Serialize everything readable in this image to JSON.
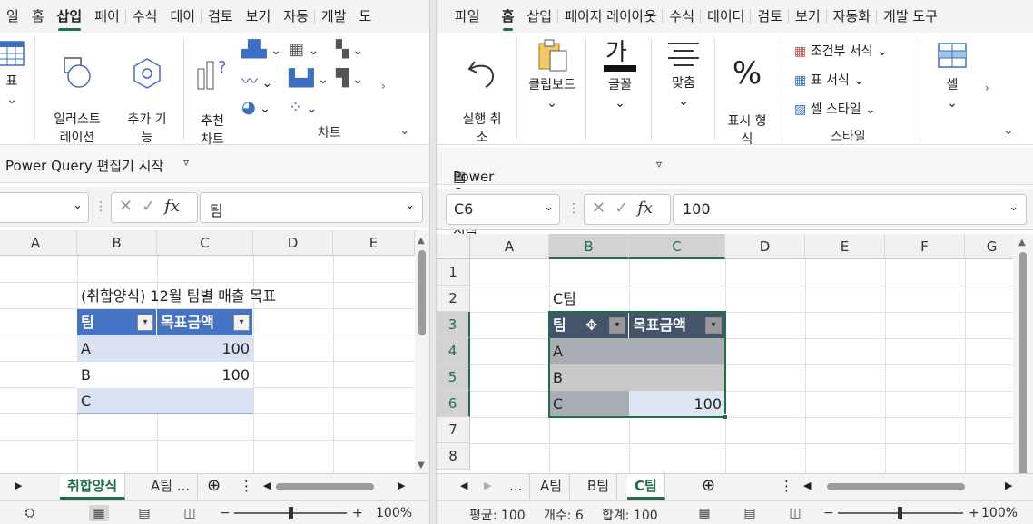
{
  "left": {
    "tabs": [
      "일",
      "홈",
      "삽입",
      "페이",
      "수식",
      "데이",
      "검토",
      "보기",
      "자동",
      "개발",
      "도"
    ],
    "ribbon": {
      "table_label": "표",
      "illustrations_label": "일러스트\n레이션",
      "addins_label": "추가 기\n능",
      "recommended_label": "추천\n차트",
      "charts_group": "차트"
    },
    "query_bar": "Power Query 편집기 시작",
    "formula": {
      "name": "",
      "value": "팀"
    },
    "columns": [
      "A",
      "B",
      "C",
      "D",
      "E"
    ],
    "title": "(취합양식) 12월 팀별 매출 목표",
    "table": {
      "headers": [
        "팀",
        "목표금액"
      ],
      "rows": [
        [
          "A",
          "100"
        ],
        [
          "B",
          "100"
        ],
        [
          "C",
          ""
        ]
      ]
    },
    "sheets": [
      "취합양식",
      "A팀 ..."
    ],
    "zoom": "100%"
  },
  "right": {
    "tabs": [
      "파일",
      "홈",
      "삽입",
      "페이지 레이아웃",
      "수식",
      "데이터",
      "검토",
      "보기",
      "자동화",
      "개발 도구"
    ],
    "ribbon": {
      "undo_label": "실행 취\n소",
      "clipboard_label": "클립보드",
      "font_label": "글꼴",
      "align_label": "맞춤",
      "number_label": "표시 형\n식",
      "cond_format": "조건부 서식",
      "table_format": "표 서식",
      "cell_style": "셀 스타일",
      "styles_group": "스타일",
      "cells_label": "셀"
    },
    "query_bar": "Power Query 편집기 시작",
    "formula": {
      "name": "C6",
      "value": "100"
    },
    "columns": [
      "A",
      "B",
      "C",
      "D",
      "E",
      "F",
      "G"
    ],
    "rows": [
      "1",
      "2",
      "3",
      "4",
      "5",
      "6",
      "7",
      "8"
    ],
    "title": "C팀",
    "table": {
      "headers": [
        "팀",
        "목표금액"
      ],
      "rows": [
        [
          "A",
          ""
        ],
        [
          "B",
          ""
        ],
        [
          "C",
          "100"
        ]
      ]
    },
    "sheets": [
      "...",
      "A팀",
      "B팀",
      "C팀"
    ],
    "status": {
      "avg": "평균: 100",
      "count": "개수: 6",
      "sum": "합계: 100"
    },
    "zoom": "100%"
  }
}
